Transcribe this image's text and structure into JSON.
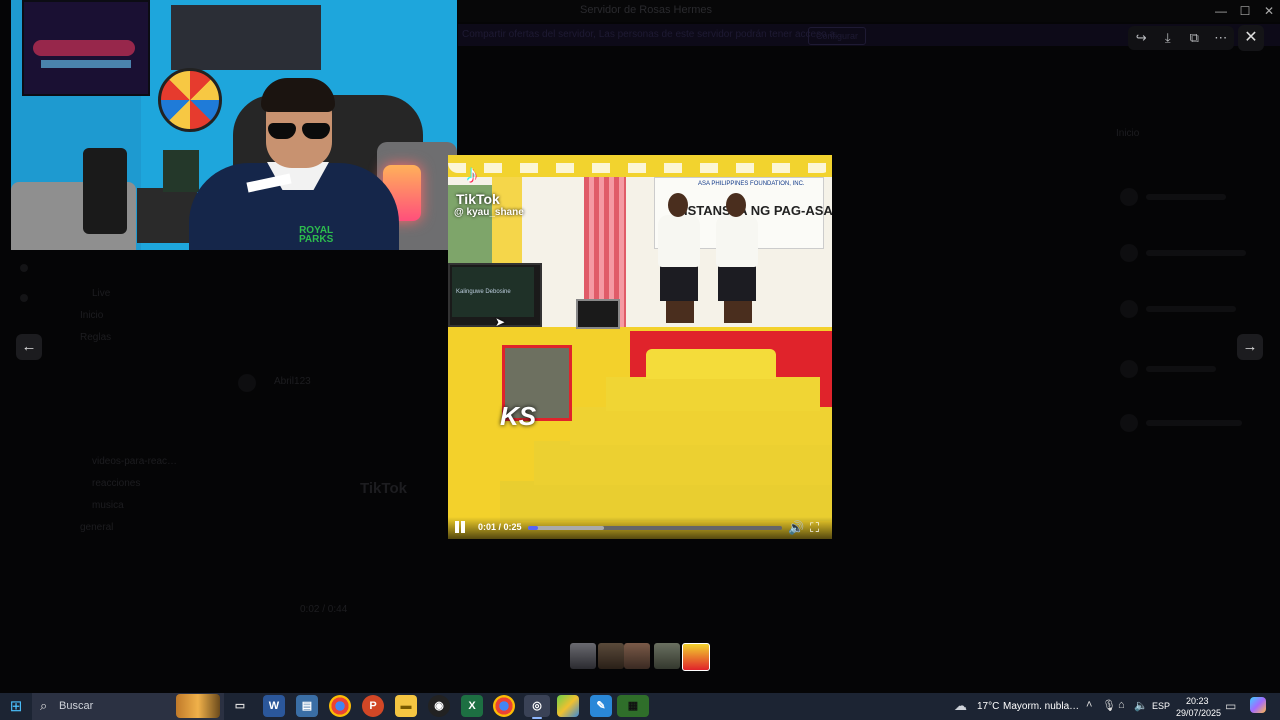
{
  "window": {
    "title": "Servidor de Rosas Hermes"
  },
  "background": {
    "banner_text": "Compartir ofertas del servidor, Las personas de este servidor podrán tener acceso a…",
    "banner_button": "Configurar",
    "channels": [
      "Live",
      "Inicio",
      "Reglas",
      "videos-para-reac…",
      "reacciones",
      "musica",
      "general"
    ],
    "chat_user": "Abril123",
    "chat_tiktok": "TikTok",
    "member_badge": "Inicio",
    "video_time": "0:02 / 0:44"
  },
  "viewer": {
    "toolbar_icons": [
      "forward-icon",
      "download-icon",
      "open-external-icon",
      "more-icon"
    ],
    "close_label": "✕",
    "prev_label": "←",
    "next_label": "→"
  },
  "video": {
    "watermark_brand": "TikTok",
    "watermark_handle": "@ kyau_shane",
    "sign_org": "ASA PHILIPPINES FOUNDATION, INC.",
    "sign_text": "ISTANSYA NG PAG-ASA",
    "monitor_text": "Kalinguwe Debosine",
    "overlay_text": "KS",
    "time_display": "0:01 / 0:25",
    "progress": 0.04,
    "buffered": 0.3
  },
  "taskbar": {
    "search_placeholder": "Buscar",
    "apps": [
      "task-view",
      "word",
      "store",
      "chrome",
      "powerpoint",
      "file-explorer",
      "obs",
      "excel",
      "chrome-profile",
      "discord",
      "bluestacks",
      "paint",
      "minecraft"
    ],
    "weather_temp": "17°C",
    "weather_desc": "Mayorm. nubla…",
    "language": "ESP",
    "time": "20:23",
    "date": "29/07/2025"
  },
  "colors": {
    "accent": "#5865f2",
    "taskbar": "#1c2433"
  }
}
